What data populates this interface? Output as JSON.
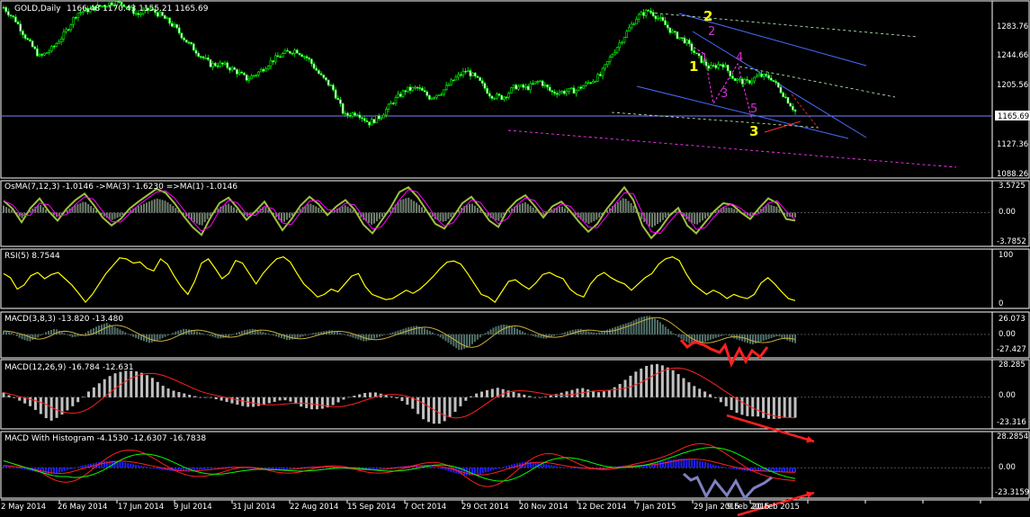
{
  "chart_data": [
    {
      "type": "candlestick",
      "title": "GOLD,Daily",
      "ohlc_header": "1166.48 1170.43 1155.21 1165.69",
      "last_price": "1165.69",
      "y_ticks": [
        "1283.76",
        "1244.66",
        "1205.56",
        "1127.36",
        "1088.26"
      ],
      "ylim": [
        1080,
        1312
      ],
      "close_path": [
        1308,
        1290,
        1262,
        1240,
        1252,
        1272,
        1300,
        1305,
        1310,
        1315,
        1312,
        1298,
        1306,
        1296,
        1282,
        1262,
        1245,
        1230,
        1230,
        1222,
        1210,
        1220,
        1235,
        1245,
        1250,
        1238,
        1215,
        1198,
        1160,
        1165,
        1150,
        1160,
        1180,
        1195,
        1198,
        1185,
        1193,
        1210,
        1222,
        1208,
        1188,
        1185,
        1200,
        1198,
        1208,
        1192,
        1193,
        1195,
        1205,
        1215,
        1245,
        1270,
        1295,
        1304,
        1290,
        1272,
        1262,
        1240,
        1225,
        1232,
        1210,
        1205,
        1215,
        1212,
        1190,
        1166
      ],
      "wave_labels_yellow": [
        "1",
        "2",
        "3"
      ],
      "wave_labels_magenta": [
        "1",
        "2",
        "3",
        "4",
        "5"
      ],
      "x_labels": [
        "2 May 2014",
        "26 May 2014",
        "17 Jun 2014",
        "9 Jul 2014",
        "31 Jul 2014",
        "22 Aug 2014",
        "15 Sep 2014",
        "7 Oct 2014",
        "29 Oct 2014",
        "20 Nov 2014",
        "12 Dec 2014",
        "7 Jan 2015",
        "29 Jan 2015",
        "20 Feb 2015"
      ],
      "x_labels_overlay": [
        "9 Feb 2015"
      ]
    },
    {
      "type": "line",
      "title": "OsMA(7,12,3) -1.0146  ->MA(3) -1.6230  =>MA(1) -1.0146",
      "y_ticks": [
        "3.5725",
        "0.00",
        "-3.7852"
      ],
      "ylim": [
        -3.7852,
        3.5725
      ],
      "values": [
        1.5,
        0.5,
        -1.2,
        0.6,
        1.8,
        0.2,
        -1.0,
        0.5,
        1.6,
        2.4,
        1.0,
        -0.6,
        -1.6,
        -0.8,
        0.5,
        1.4,
        2.2,
        3.0,
        2.5,
        1.2,
        -0.4,
        -1.8,
        -2.8,
        -0.6,
        1.2,
        1.9,
        0.6,
        -0.9,
        0.2,
        1.4,
        -0.4,
        -2.2,
        -0.8,
        0.9,
        2.0,
        1.1,
        -0.3,
        0.8,
        1.6,
        0.4,
        -1.5,
        -2.6,
        -1.0,
        0.6,
        2.6,
        3.2,
        2.0,
        0.3,
        -1.4,
        -2.0,
        -0.5,
        1.2,
        2.0,
        0.6,
        -1.0,
        -1.8,
        0.3,
        1.5,
        2.2,
        0.9,
        -0.6,
        0.8,
        1.4,
        0.2,
        -1.2,
        -2.4,
        -1.4,
        0.4,
        1.8,
        3.2,
        1.6,
        -1.6,
        -3.2,
        -2.0,
        -0.4,
        0.6,
        -1.6,
        -2.6,
        -1.2,
        0.2,
        1.2,
        1.0,
        0.0,
        -0.8,
        0.6,
        1.8,
        1.2,
        -0.8,
        -1.0
      ]
    },
    {
      "type": "line",
      "title": "RSI(5) 8.7544",
      "y_ticks": [
        "100",
        "0"
      ],
      "ylim": [
        0,
        100
      ],
      "values": [
        60,
        52,
        30,
        38,
        56,
        62,
        50,
        58,
        62,
        50,
        38,
        22,
        5,
        20,
        40,
        60,
        75,
        90,
        88,
        80,
        82,
        70,
        65,
        88,
        78,
        55,
        35,
        20,
        45,
        80,
        88,
        70,
        50,
        60,
        85,
        80,
        60,
        40,
        60,
        75,
        88,
        92,
        82,
        60,
        40,
        28,
        15,
        20,
        30,
        25,
        40,
        55,
        60,
        35,
        20,
        15,
        10,
        12,
        20,
        28,
        22,
        30,
        42,
        55,
        70,
        82,
        84,
        78,
        60,
        40,
        20,
        15,
        5,
        25,
        45,
        48,
        38,
        30,
        42,
        58,
        62,
        55,
        50,
        30,
        20,
        15,
        40,
        55,
        62,
        52,
        45,
        40,
        28,
        40,
        52,
        60,
        78,
        88,
        92,
        85,
        60,
        40,
        30,
        20,
        28,
        22,
        12,
        20,
        15,
        12,
        20,
        42,
        52,
        40,
        25,
        12,
        8
      ]
    },
    {
      "type": "bar",
      "title": "MACD(3,8,3) -13.820 -13.480",
      "y_ticks": [
        "26.073",
        "0.00",
        "-27.427"
      ],
      "ylim": [
        -27.427,
        26.073
      ],
      "values": [
        5,
        2,
        -6,
        -10,
        -4,
        4,
        8,
        2,
        -4,
        -2,
        6,
        12,
        16,
        10,
        4,
        -3,
        -8,
        -12,
        -8,
        -2,
        4,
        8,
        6,
        2,
        -2,
        -6,
        -4,
        2,
        6,
        8,
        4,
        0,
        -4,
        -8,
        -6,
        -2,
        2,
        4,
        6,
        3,
        -2,
        -6,
        -10,
        -6,
        -2,
        2,
        6,
        10,
        12,
        8,
        2,
        -6,
        -14,
        -22,
        -18,
        -8,
        2,
        10,
        14,
        12,
        6,
        0,
        -4,
        -6,
        -2,
        2,
        6,
        8,
        4,
        2,
        6,
        10,
        14,
        18,
        24,
        26,
        20,
        10,
        0,
        -8,
        -14,
        -12,
        -8,
        -4,
        0,
        -6,
        -10,
        -14,
        -10,
        -6,
        -2,
        -8,
        -12
      ]
    },
    {
      "type": "bar",
      "title": "MACD(12,26,9) -16.784 -12.631",
      "y_ticks": [
        "28.285",
        "0.00",
        "-23.316"
      ],
      "ylim": [
        -23.316,
        28.285
      ],
      "values": [
        4,
        0,
        -4,
        -8,
        -14,
        -20,
        -16,
        -10,
        -4,
        4,
        10,
        16,
        20,
        22,
        22,
        20,
        16,
        10,
        6,
        4,
        2,
        0,
        0,
        -2,
        -4,
        -6,
        -8,
        -8,
        -6,
        -4,
        -2,
        -4,
        -8,
        -10,
        -10,
        -8,
        -4,
        0,
        2,
        4,
        4,
        2,
        0,
        -4,
        -10,
        -18,
        -22,
        -22,
        -16,
        -8,
        0,
        4,
        6,
        8,
        6,
        4,
        2,
        0,
        0,
        2,
        4,
        6,
        8,
        6,
        4,
        6,
        10,
        16,
        22,
        26,
        28,
        26,
        22,
        16,
        10,
        6,
        2,
        -4,
        -10,
        -14,
        -16,
        -16,
        -18,
        -18,
        -17,
        -17
      ]
    },
    {
      "type": "bar",
      "title": "MACD With Histogram -4.1530 -12.6307 -16.7838",
      "y_ticks": [
        "28.2854",
        "0.00",
        "-23.3159"
      ],
      "ylim": [
        -23.3159,
        28.2854
      ],
      "values": [
        2,
        0,
        -2,
        -4,
        -6,
        -4,
        -1,
        2,
        4,
        6,
        6,
        4,
        2,
        0,
        -2,
        -3,
        -3,
        -2,
        -1,
        0,
        1,
        0,
        -1,
        -2,
        -2,
        -1,
        0,
        1,
        1,
        0,
        -1,
        -2,
        -2,
        -1,
        0,
        1,
        2,
        2,
        1,
        -2,
        -5,
        -7,
        -6,
        -3,
        0,
        3,
        5,
        5,
        3,
        1,
        0,
        -1,
        -1,
        0,
        1,
        2,
        2,
        3,
        5,
        7,
        8,
        7,
        5,
        2,
        0,
        -2,
        -3,
        -3,
        -4,
        -4,
        -4
      ]
    }
  ]
}
